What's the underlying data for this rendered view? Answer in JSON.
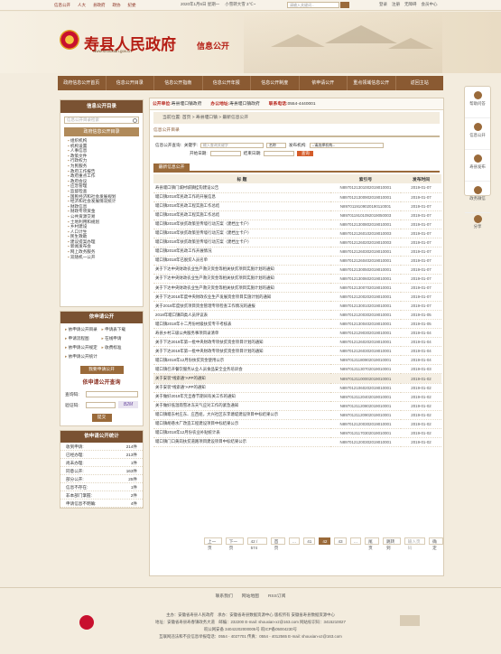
{
  "topbar": {
    "links": [
      "信息公开",
      "人大",
      "县政府",
      "政协",
      "纪委"
    ],
    "date": "2020年1月6日 星期一",
    "weather": "小雪转大雪 3℃~",
    "search_placeholder": "请输入关键词...",
    "right": [
      "登录",
      "注册",
      "无障碍",
      "会员中心"
    ]
  },
  "header": {
    "site_title": "寿县人民政府",
    "site_url": "www.shouxian.gov.cn",
    "section": "信息公开"
  },
  "nav": [
    "政府信息公开首页",
    "信息公开目录",
    "信息公开指南",
    "信息公开年报",
    "信息公开制度",
    "依申请公开",
    "重点领域信息公开",
    "返回主站"
  ],
  "sidebar": {
    "catalog_head": "信息公开目录",
    "search_placeholder": "信息公开目录检索",
    "sub_head": "政府信息公开目录",
    "tree": [
      "组织机构",
      "机构设置",
      "人事信息",
      "政策文件",
      "行政权力",
      "为民服务",
      "政府工作报告",
      "政府重点工作",
      "政府会议",
      "应急管理",
      "监督检查",
      "国民经济和社会发展规划",
      "经济和社会发展情况统计",
      "财政信息",
      "财政专项资金",
      "公共资源交易",
      "土地利用和规划",
      "乡村建设",
      "人口计生",
      "民生救助",
      "建议提案办理",
      "新闻发布会",
      "网上政务服务",
      "双随机一公开"
    ],
    "apply_head": "依申请公开",
    "apply_links": [
      "依申请公开目录",
      "申请表下载",
      "申请流程图",
      "在线申请",
      "依申请公开规定",
      "收费标准",
      "依申请公开统计"
    ],
    "apply_btn": "我要申请公开",
    "query_title": "依申请公开查询",
    "query_code_label": "查询码:",
    "captcha_label": "验证码:",
    "captcha_text": "B2M",
    "query_btn": "提交",
    "stats_head": "依申请公开统计",
    "stats": [
      {
        "label": "收到申请:",
        "value": "214件"
      },
      {
        "label": "已经办理:",
        "value": "213件"
      },
      {
        "label": "尚未办理:",
        "value": "1件"
      },
      {
        "label": "同意公开:",
        "value": "163件"
      },
      {
        "label": "部分公开:",
        "value": "25件"
      },
      {
        "label": "信息不存在:",
        "value": "1件"
      },
      {
        "label": "非本部门掌握:",
        "value": "2件"
      },
      {
        "label": "申请信息不明确:",
        "value": "4件"
      }
    ]
  },
  "main": {
    "unit_bar": {
      "unit_label": "公开单位:",
      "unit": "寿县堰口镇政府",
      "addr_label": "办公地址:",
      "addr": "寿县堰口镇政府",
      "phone_label": "联系电话:",
      "phone": "0554-4440001"
    },
    "breadcrumb": "当前位置: 首页 > 寿县堰口镇 > 最新信息公开",
    "catalog_label": "信息公开目录",
    "search": {
      "label": "信息公开查询:",
      "keyword_label": "关键字:",
      "keyword_placeholder": "输入查询关键字",
      "field": "名称",
      "org_label": "发布机构:",
      "org_placeholder": "--请选择机构--",
      "start_label": "开始日期:",
      "end_label": "结束日期:",
      "btn": "查询"
    },
    "tab": "最新信息公开",
    "table": {
      "headers": [
        "标 题",
        "索引号",
        "发布时间"
      ],
      "rows": [
        {
          "t": "寿县堰口镇门城村城镇挂钩建设公告",
          "n": "N8970121301002019010001",
          "d": "2019-01-07"
        },
        {
          "t": "堰口镇2018年民政工作的开展信息",
          "n": "N8970121300902019010001",
          "d": "2019-01-07"
        },
        {
          "t": "堰口镇2018年民政工程实施工作总结",
          "n": "N8970119109020190110001",
          "d": "2019-01-07"
        },
        {
          "t": "堰口镇2018年民政工程实施工作总结",
          "n": "N8970119101092019050003",
          "d": "2019-01-07"
        },
        {
          "t": "堰口镇2018年扶贫政策宣传墙行动方案（建档立卡户）",
          "n": "N8970121300802019010001",
          "d": "2019-01-07"
        },
        {
          "t": "堰口镇2018年扶贫政策宣传墙行动方案（建档立卡户）",
          "n": "N8970121260102019010003",
          "d": "2019-01-07"
        },
        {
          "t": "堰口镇2018年扶贫政策宣传墙行动方案（建档立卡户）",
          "n": "N8970121260202019010003",
          "d": "2019-01-07"
        },
        {
          "t": "堰口镇2018年民政工作开展情况",
          "n": "N8970121260302019010001",
          "d": "2019-01-07"
        },
        {
          "t": "堰口镇2018年已脱贫人员名单",
          "n": "N8970121260402019010001",
          "d": "2019-01-07"
        },
        {
          "t": "关于下达中央财政农业生产救灾资金等相关扶贫项目实施计划的通知",
          "n": "N8970121300502019010001",
          "d": "2019-01-07"
        },
        {
          "t": "关于下达中央财政农业生产救灾资金等相关扶贫项目实施计划的通知",
          "n": "N8970121300602019010001",
          "d": "2019-01-07"
        },
        {
          "t": "关于下达中央财政农业生产救灾资金等相关扶贫项目实施计划的通知",
          "n": "N8970121300702019010001",
          "d": "2019-01-07"
        },
        {
          "t": "关于下达2018年度中央财政农业生产发展资金项目实施计划的通知",
          "n": "N8970121200202019010001",
          "d": "2019-01-07"
        },
        {
          "t": "关于2018年度扶贫项目资金管理专项检查工作情况的通报",
          "n": "N8970121300102019010001",
          "d": "2019-01-07"
        },
        {
          "t": "2018年堰口镇四类人员评议表",
          "n": "N8970121200302019010001",
          "d": "2019-01-05"
        },
        {
          "t": "堰口镇2018年十二月份村级扶贫专干考核表",
          "n": "N8970121300402019010001",
          "d": "2019-01-05"
        },
        {
          "t": "寿县乡村三级公共服务事项目录清单",
          "n": "N8970121290302019010001",
          "d": "2019-01-04"
        },
        {
          "t": "关于下达2019年第一批中央财政专项扶贫资金项目计划的通知",
          "n": "N8970121260202019010001",
          "d": "2019-01-04"
        },
        {
          "t": "关于下达2019年第一批中央财政专项扶贫资金项目计划的通知",
          "n": "N8970121260302019010001",
          "d": "2019-01-04"
        },
        {
          "t": "堰口镇2018年12月份扶贫资金使用公示",
          "n": "N8970121180902019010001",
          "d": "2019-01-04"
        },
        {
          "t": "堰口镇召开餐饮服务从业人员食品安全业务培训会",
          "n": "N8970121130702019010001",
          "d": "2019-01-03"
        },
        {
          "t": "关于安装“线索通”APP的通知",
          "n": "N8970121100002019010001",
          "d": "2019-01-02"
        },
        {
          "t": "关于安装“线索通”APP的通知",
          "n": "N8970121060202019010001",
          "d": "2019-01-02"
        },
        {
          "t": "关于做好2019年元旦春节期间有关工作的通知",
          "n": "N8970121120402019010001",
          "d": "2019-01-02"
        },
        {
          "t": "关于做好低温雨雪冰冻天气应对工作的紧急通知",
          "n": "N8970121120802019010001",
          "d": "2019-01-02"
        },
        {
          "t": "堰口镇堰东村庄东、庄西组，大兴社区东李塘堤建设项目中标结果公示",
          "n": "N8970121120902019010001",
          "d": "2019-01-02"
        },
        {
          "t": "堰口镇胡巷水厂改造工程建设项目中标结果公示",
          "n": "N8970121200302019010001",
          "d": "2019-01-02"
        },
        {
          "t": "堰口镇2018年12月份农业补贴统计表",
          "n": "N8970121170302019010001",
          "d": "2019-01-02"
        },
        {
          "t": "堰口镇门口黄岗扶贫道路项目建设项目中标结果公示",
          "n": "N8970121200302019010001",
          "d": "2019-01-02"
        }
      ]
    },
    "pager": [
      "上一页",
      "下一页",
      "42 / 574",
      "首页",
      "…",
      "41",
      "42",
      "43",
      "…",
      "尾页",
      "跳转到",
      "确定"
    ],
    "pager_jump_placeholder": "输入页码"
  },
  "floatbar": [
    "帮助问答",
    "信息公开",
    "寿县发布",
    "政务微信",
    "分享"
  ],
  "footer": {
    "links": [
      "联系我们",
      "网站地图",
      "RSS订阅"
    ],
    "lines": [
      "主办：安徽省寿县人民政府　承办：安徽省寿县数据资源中心 版权所有 安徽省寿县数据资源中心",
      "地址：安徽省寿县寿春镇政务大道　邮编：232200 E-mail: shouxian-xz@163.com 网站标识码：3415210027",
      "皖公网安备 34042202000005号 皖ICP备05004230号",
      "互联网违法和不良信息举报电话：0554 - 4027701 传真：0554 - 4012565 E-mail: shouxian-xz@163.com"
    ]
  },
  "colors": {
    "brand_red": "#b51d14",
    "nav_brown": "#8a5a32",
    "accent": "#9a6a3a"
  }
}
